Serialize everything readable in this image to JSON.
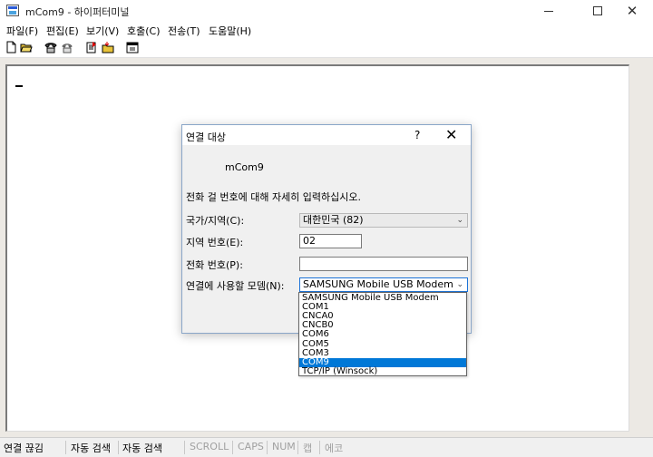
{
  "window": {
    "title": "mCom9 - 하이퍼터미널",
    "minimize_glyph": "",
    "close_glyph": "✕"
  },
  "menu": [
    "파일(F)",
    "편집(E)",
    "보기(V)",
    "호출(C)",
    "전송(T)",
    "도움말(H)"
  ],
  "toolbar": {
    "icons": [
      "new-file-icon",
      "open-folder-icon",
      "call-icon",
      "disconnect-icon",
      "send-icon",
      "receive-icon",
      "properties-icon"
    ]
  },
  "dialog": {
    "title": "연결 대상",
    "help_glyph": "?",
    "close_glyph": "✕",
    "connection_name": "mCom9",
    "prompt": "전화 걸 번호에 대해 자세히 입력하십시오.",
    "country_label": "국가/지역(C):",
    "country_value": "대한민국 (82)",
    "area_label": "지역 번호(E):",
    "area_value": "02",
    "phone_label": "전화 번호(P):",
    "phone_value": "",
    "modem_label": "연결에 사용할 모뎀(N):",
    "modem_value": "SAMSUNG Mobile USB Modem",
    "arrow_glyph": "⌄"
  },
  "modem_options": [
    "SAMSUNG Mobile USB Modem",
    "COM1",
    "CNCA0",
    "CNCB0",
    "COM6",
    "COM5",
    "COM3",
    "COM9",
    "TCP/IP (Winsock)"
  ],
  "modem_selected_index": 7,
  "status": {
    "connection": "연결 끊김",
    "detect1": "자동 검색",
    "detect2": "자동 검색",
    "scroll": "SCROLL",
    "caps": "CAPS",
    "num": "NUM",
    "capture": "캡",
    "echo": "에코"
  }
}
